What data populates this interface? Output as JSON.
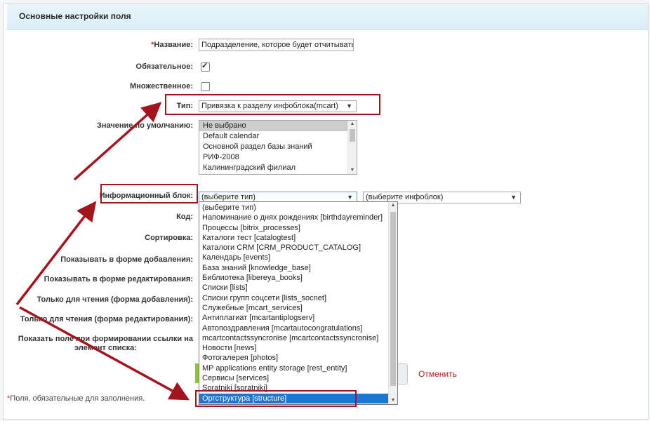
{
  "header": {
    "title": "Основные настройки поля"
  },
  "fields": {
    "name_label": "Название:",
    "name_value": "Подразделение, которое будет отчитываться",
    "required_label": "Обязательное:",
    "multiple_label": "Множественное:",
    "type_label": "Тип:",
    "type_value": "Привязка к разделу инфоблока(mcart)",
    "default_label": "Значение по умолчанию:",
    "default_options": [
      "Не выбрано",
      "Default calendar",
      "Основной раздел базы знаний",
      "РИФ-2008",
      "Калининградский филиал"
    ],
    "iblock_label": "Информационный блок:",
    "iblock_type_value": "(выберите тип)",
    "iblock_value": "(выберите инфоблок)",
    "code_label": "Код:",
    "sort_label": "Сортировка:",
    "show_add_label": "Показывать в форме добавления:",
    "show_edit_label": "Показывать в форме редактирования:",
    "readonly_add_label": "Только для чтения (форма добавления):",
    "readonly_edit_label": "Только для чтения (форма редактирования):",
    "show_link_label_1": "Показать поле при формировании ссылки на",
    "show_link_label_2": "элемент списка:"
  },
  "iblock_type_options": [
    "(выберите тип)",
    "Напоминание о днях рождениях [birthdayreminder]",
    "Процессы [bitrix_processes]",
    "Каталоги тест [catalogtest]",
    "Каталоги CRM [CRM_PRODUCT_CATALOG]",
    "Календарь [events]",
    "База знаний [knowledge_base]",
    "Библиотека [libereya_books]",
    "Списки [lists]",
    "Списки групп соцсети [lists_socnet]",
    "Служебные [mcart_services]",
    "Антиплагиат [mcartantiplogserv]",
    "Автопоздравления [mcartautocongratulations]",
    "mcartcontactssyncronise [mcartcontactssyncronise]",
    "Новости [news]",
    "Фотогалерея [photos]",
    "MP applications entity storage [rest_entity]",
    "Сервисы [services]",
    "Soratniki [soratniki]",
    "Оргструктура [structure]"
  ],
  "actions": {
    "cancel_label": "Отменить"
  },
  "footnote": {
    "star": "*",
    "text": "Поля, обязательные для заполнения."
  },
  "colors": {
    "annotation": "#a3151e",
    "selection": "#1e74d0",
    "required": "#d12a2a"
  }
}
